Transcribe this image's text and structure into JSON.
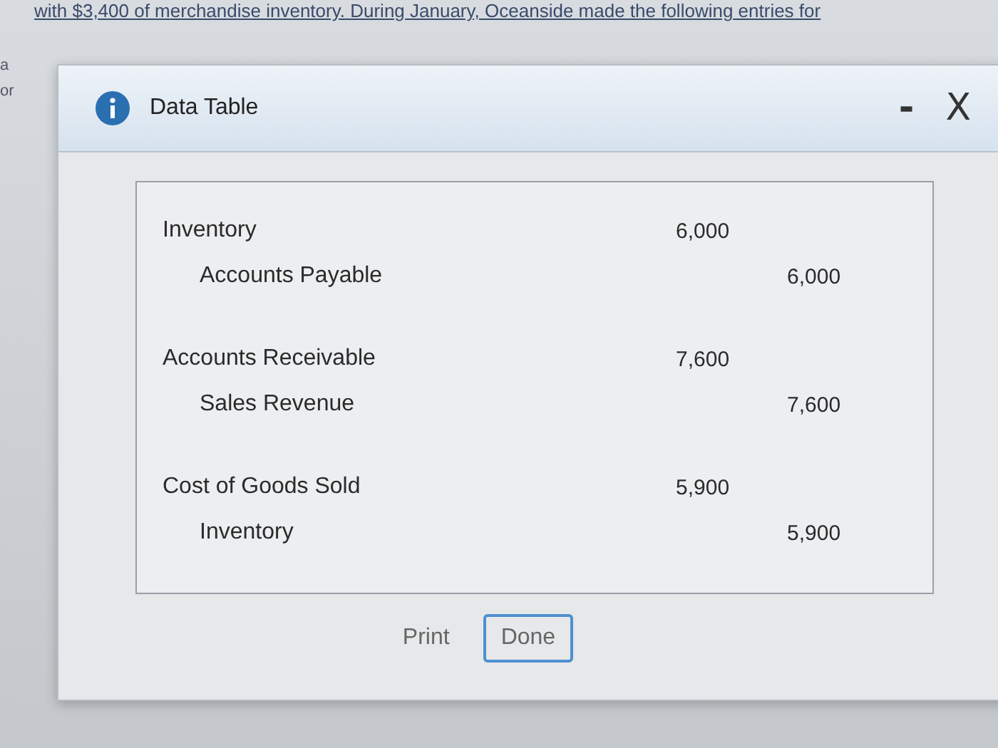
{
  "background": {
    "sentence": "with $3,400 of merchandise inventory. During January, Oceanside made the following entries for",
    "margin_fragments": [
      "a",
      "or"
    ]
  },
  "dialog": {
    "title": "Data Table",
    "minimize": "-",
    "close": "X"
  },
  "entries": [
    {
      "lines": [
        {
          "kind": "debit",
          "account": "Inventory",
          "amount": "6,000"
        },
        {
          "kind": "credit",
          "account": "Accounts Payable",
          "amount": "6,000"
        }
      ]
    },
    {
      "lines": [
        {
          "kind": "debit",
          "account": "Accounts Receivable",
          "amount": "7,600"
        },
        {
          "kind": "credit",
          "account": "Sales Revenue",
          "amount": "7,600"
        }
      ]
    },
    {
      "lines": [
        {
          "kind": "debit",
          "account": "Cost of Goods Sold",
          "amount": "5,900"
        },
        {
          "kind": "credit",
          "account": "Inventory",
          "amount": "5,900"
        }
      ]
    }
  ],
  "buttons": [
    {
      "label": "Print",
      "focused": false
    },
    {
      "label": "Done",
      "focused": true
    }
  ]
}
